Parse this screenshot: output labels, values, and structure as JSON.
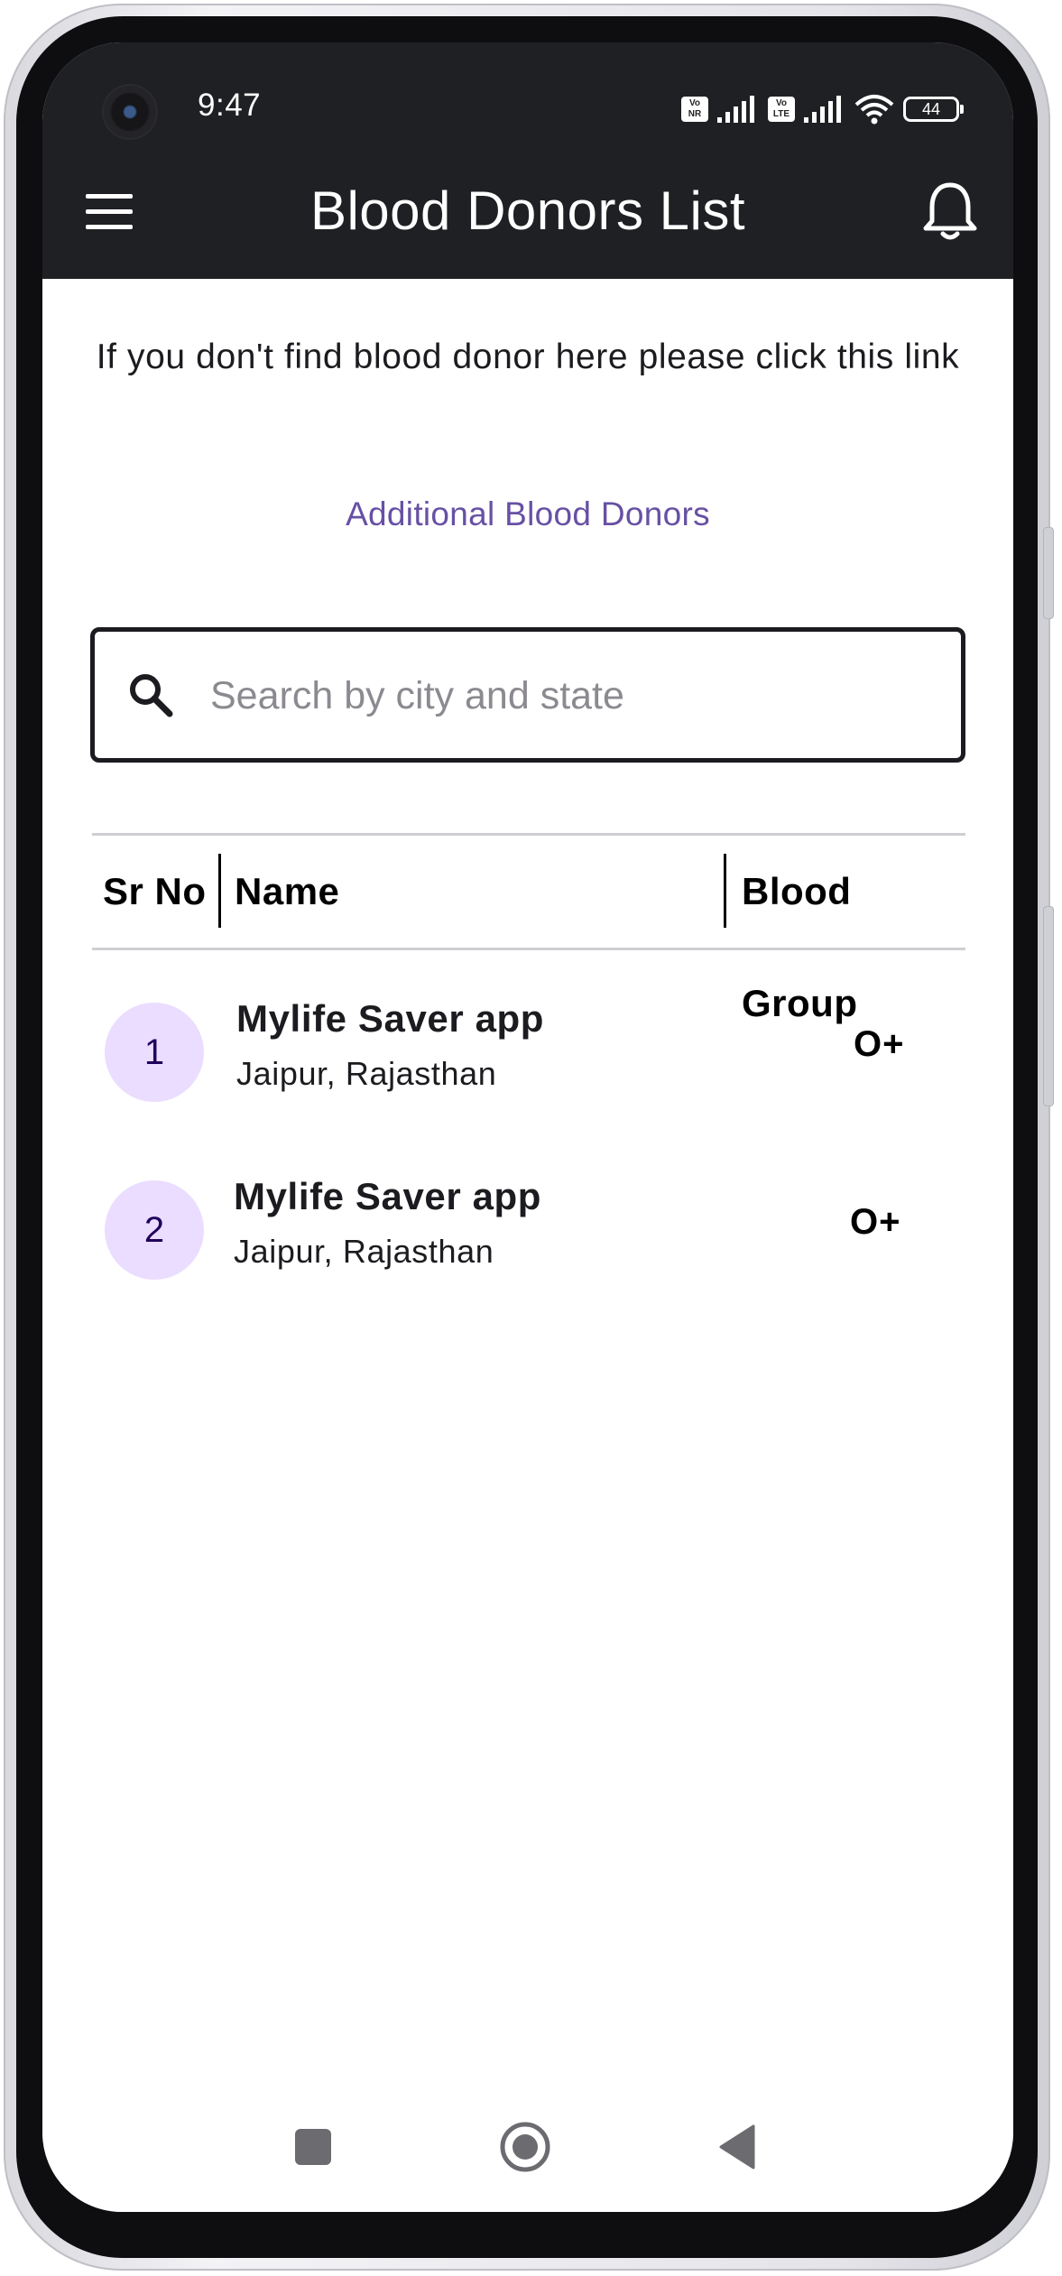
{
  "status_bar": {
    "time": "9:47",
    "volte1": [
      "Vo",
      "NR"
    ],
    "volte2": [
      "Vo",
      "LTE"
    ],
    "battery": "44"
  },
  "app_bar": {
    "title": "Blood Donors List",
    "menu_icon": "hamburger-menu-icon",
    "notification_icon": "bell-icon"
  },
  "info_text": "If you don't find blood donor here please click this link",
  "additional_link": "Additional Blood Donors",
  "search": {
    "placeholder": "Search by city and state",
    "value": ""
  },
  "table": {
    "headers": [
      "Sr No",
      "Name",
      "Blood Group"
    ],
    "rows": [
      {
        "sr": "1",
        "name": "Mylife Saver app",
        "location": "Jaipur, Rajasthan",
        "blood_group": "O+"
      },
      {
        "sr": "2",
        "name": "Mylife Saver app",
        "location": "Jaipur, Rajasthan",
        "blood_group": "O+"
      }
    ]
  },
  "navigation": {
    "recents": "square-recents-icon",
    "home": "circle-home-icon",
    "back": "triangle-back-icon"
  },
  "colors": {
    "app_bar": "#1f2023",
    "link": "#6750a4",
    "avatar_bg": "#eaddff",
    "avatar_text": "#21005d"
  }
}
